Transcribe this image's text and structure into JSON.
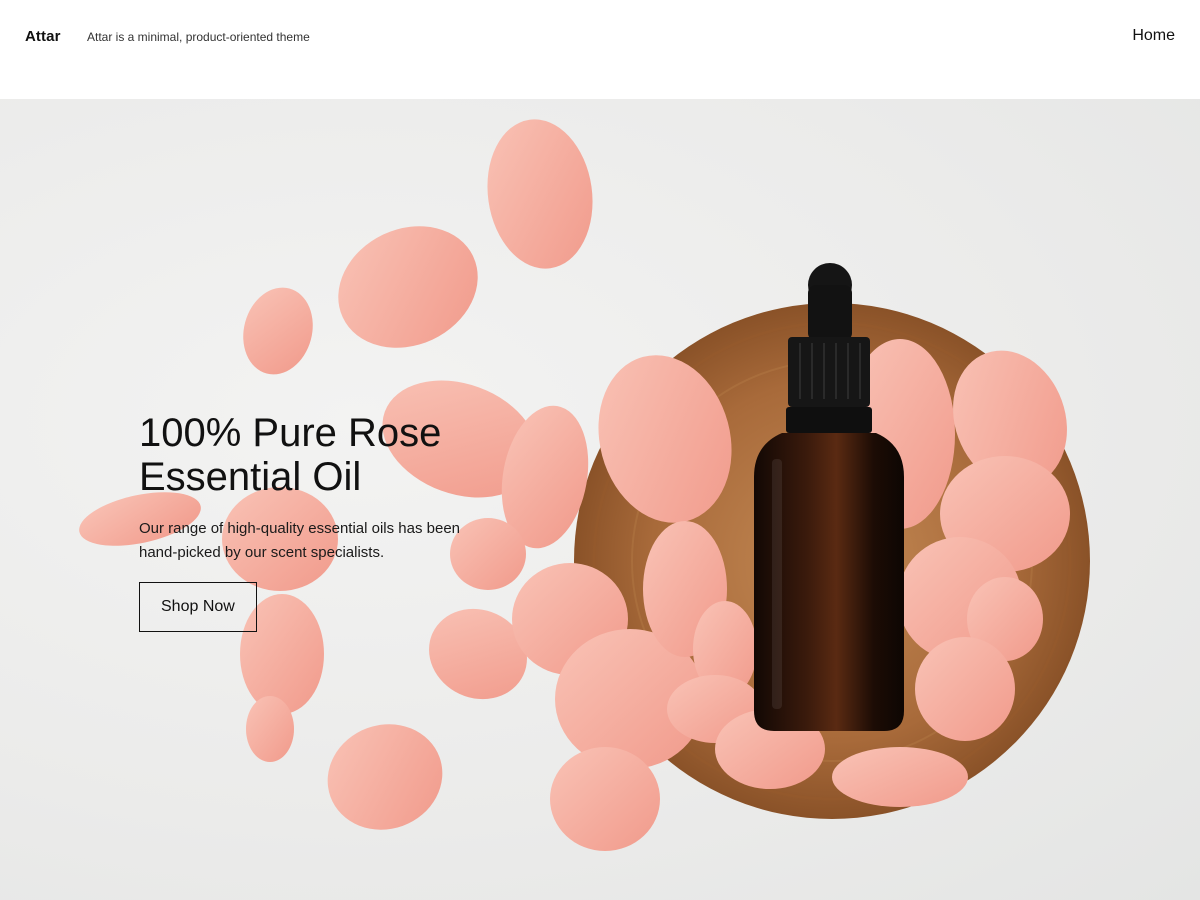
{
  "header": {
    "site_title": "Attar",
    "tagline": "Attar is a minimal, product-oriented theme",
    "nav": {
      "home_label": "Home"
    }
  },
  "hero": {
    "title_line1": "100% Pure Rose",
    "title_line2": "Essential Oil",
    "text_line1": "Our range of high-quality essential oils has been",
    "text_line2": "hand-picked by our scent specialists.",
    "button_label": "Shop Now",
    "image": {
      "subject": "amber dropper bottle on wooden plate with rose petals",
      "colors": {
        "petal": "#f4a99b",
        "wood": "#a86a3a",
        "bottle": "#2a140b",
        "background": "#ececeb"
      }
    }
  }
}
